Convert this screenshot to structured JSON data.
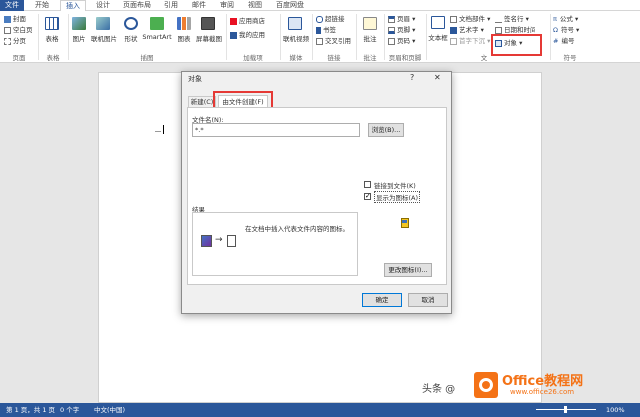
{
  "tabs": [
    "文件",
    "开始",
    "插入",
    "设计",
    "页面布局",
    "引用",
    "邮件",
    "审阅",
    "视图",
    "百度网盘"
  ],
  "ribbon": {
    "pages": {
      "cover": "封面",
      "blank": "空白页",
      "break": "分页",
      "group": "页面"
    },
    "tables": {
      "table": "表格",
      "group": "表格"
    },
    "illustrations": {
      "picture": "图片",
      "online_picture": "联机图片",
      "shapes": "形状",
      "smartart": "SmartArt",
      "chart": "图表",
      "screenshot": "屏幕截图",
      "group": "插图"
    },
    "addins": {
      "store": "应用商店",
      "my_apps": "我的应用",
      "group": "加载项"
    },
    "media": {
      "online_video": "联机视频",
      "group": "媒体"
    },
    "links": {
      "hyperlink": "超链接",
      "bookmark": "书签",
      "cross_ref": "交叉引用",
      "group": "链接"
    },
    "comments": {
      "comment": "批注",
      "group": "批注"
    },
    "header_footer": {
      "header": "页眉",
      "footer": "页脚",
      "page_number": "页码",
      "group": "页眉和页脚"
    },
    "text": {
      "textbox": "文本框",
      "quick_parts": "文档部件",
      "wordart": "艺术字",
      "dropcap": "首字下沉",
      "signature": "签名行",
      "datetime": "日期和时间",
      "object": "对象",
      "group": "文"
    },
    "symbols": {
      "formula": "公式",
      "symbol": "符号",
      "number": "编号",
      "group": "符号"
    }
  },
  "dialog": {
    "title": "对象",
    "help": "?",
    "close": "✕",
    "tab_new": "新建(C)",
    "tab_from_file": "由文件创建(F)",
    "filename_label": "文件名(N):",
    "filename_value": "*.*",
    "browse": "浏览(B)...",
    "link_to_file": "链接到文件(K)",
    "display_as_icon": "显示为图标(A)",
    "result_label": "结果",
    "result_text": "在文档中插入代表文件内容的图标。",
    "change_icon": "更改图标(I)...",
    "ok": "确定",
    "cancel": "取消"
  },
  "status": {
    "page": "第 1 页，共 1 页",
    "words": "0 个字",
    "language": "中文(中国)",
    "zoom": "100%"
  },
  "watermark": {
    "text": "头条 @",
    "brand": "Office教程网",
    "sub": "www.office26.com"
  },
  "colors": {
    "accent": "#2b579a",
    "highlight": "#e53935",
    "brand_orange": "#f47216"
  }
}
